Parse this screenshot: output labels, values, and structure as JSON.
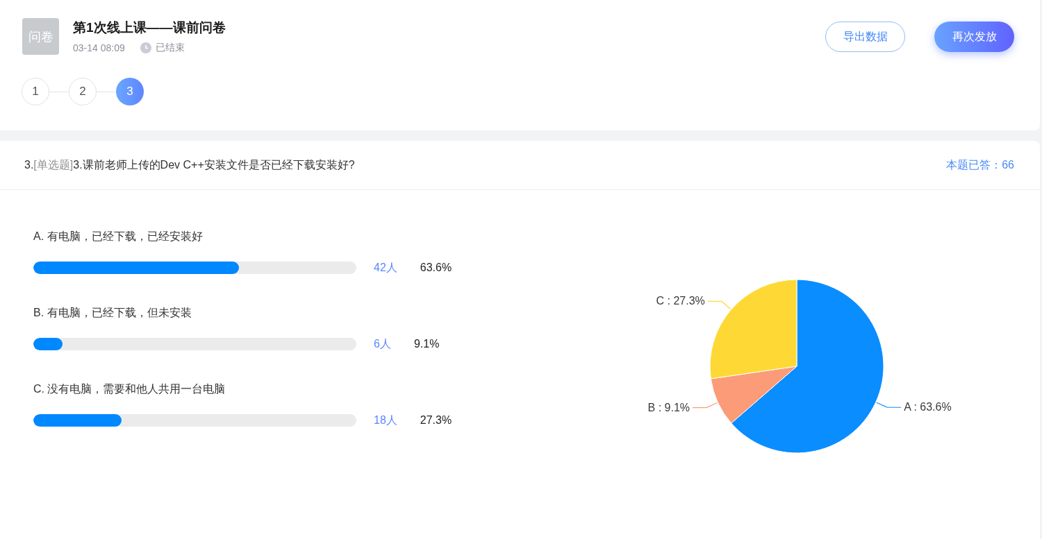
{
  "header": {
    "tile_text": "问卷",
    "title": "第1次线上课——课前问卷",
    "date": "03-14 08:09",
    "status": "已结束"
  },
  "actions": [
    {
      "label": "导出数据",
      "kind": "outline"
    },
    {
      "label": "再次发放",
      "kind": "primary"
    }
  ],
  "steps": [
    {
      "label": "1",
      "selected": false
    },
    {
      "label": "2",
      "selected": false
    },
    {
      "label": "3",
      "selected": true
    }
  ],
  "question": {
    "number": "3.",
    "type_label": "[单选题]",
    "text": "3.课前老师上传的Dev C++安装文件是否已经下载安装好?",
    "answered": "本题已答：66",
    "options": [
      {
        "label": "A. 有电脑，已经下载，已经安装好",
        "level": 0.636,
        "count": "42人",
        "percent": "63.6%"
      },
      {
        "label": "B. 有电脑，已经下载，但未安装",
        "level": 0.091,
        "count": "6人",
        "percent": "9.1%"
      },
      {
        "label": "C. 没有电脑，需要和他人共用一台电脑",
        "level": 0.273,
        "count": "18人",
        "percent": "27.3%"
      }
    ],
    "chart_data": {
      "type": "pie",
      "values": [
        63.6,
        9.1,
        27.3
      ],
      "colors": [
        "#0a8dff",
        "#fc9b78",
        "#fed935"
      ],
      "value_labels": [
        "A : 63.6%",
        "B : 9.1%",
        "C : 27.3%"
      ]
    }
  }
}
